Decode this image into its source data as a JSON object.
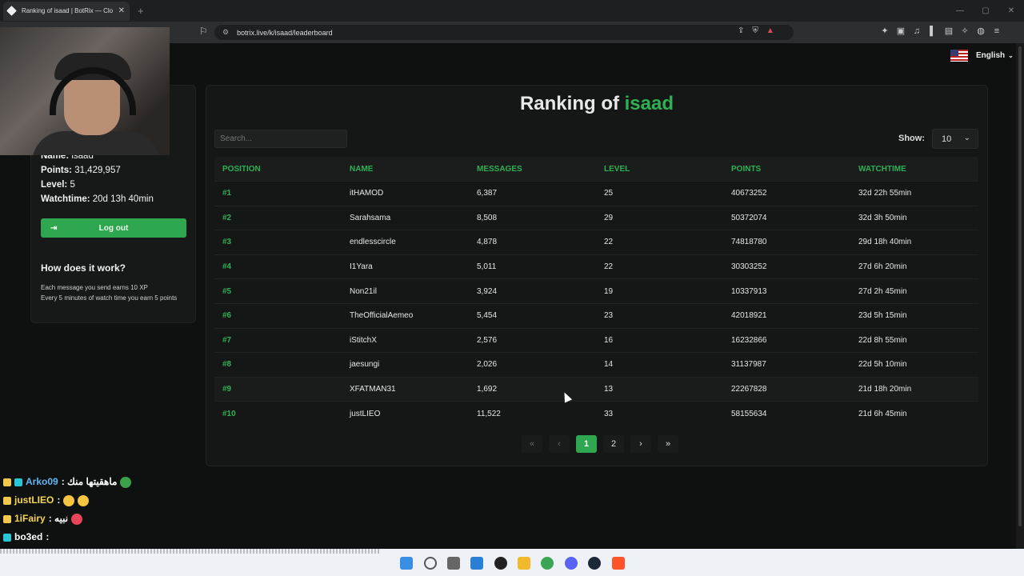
{
  "browser": {
    "tab_title": "Ranking of isaad | BotRix — Clo",
    "url": "botrix.live/k/isaad/leaderboard"
  },
  "language": {
    "label": "English"
  },
  "sidebar": {
    "name_label": "Name:",
    "name_value": "isaad",
    "points_label": "Points:",
    "points_value": "31,429,957",
    "level_label": "Level:",
    "level_value": "5",
    "watchtime_label": "Watchtime:",
    "watchtime_value": "20d 13h 40min",
    "logout_label": "Log out",
    "how_title": "How does it work?",
    "how_line1": "Each message you send earns 10 XP",
    "how_line2": "Every 5 minutes of watch time you earn 5 points"
  },
  "ranking": {
    "title_prefix": "Ranking of",
    "title_name": "isaad",
    "search_placeholder": "Search...",
    "show_label": "Show:",
    "show_value": "10",
    "columns": [
      "POSITION",
      "NAME",
      "MESSAGES",
      "LEVEL",
      "POINTS",
      "WATCHTIME"
    ],
    "rows": [
      {
        "pos": "#1",
        "name": "itHAMOD",
        "messages": "6,387",
        "level": "25",
        "points": "40673252",
        "watchtime": "32d 22h 55min"
      },
      {
        "pos": "#2",
        "name": "Sarahsama",
        "messages": "8,508",
        "level": "29",
        "points": "50372074",
        "watchtime": "32d 3h 50min"
      },
      {
        "pos": "#3",
        "name": "endlesscircle",
        "messages": "4,878",
        "level": "22",
        "points": "74818780",
        "watchtime": "29d 18h 40min"
      },
      {
        "pos": "#4",
        "name": "I1Yara",
        "messages": "5,011",
        "level": "22",
        "points": "30303252",
        "watchtime": "27d 6h 20min"
      },
      {
        "pos": "#5",
        "name": "Non21il",
        "messages": "3,924",
        "level": "19",
        "points": "10337913",
        "watchtime": "27d 2h 45min"
      },
      {
        "pos": "#6",
        "name": "TheOfficialAemeo",
        "messages": "5,454",
        "level": "23",
        "points": "42018921",
        "watchtime": "23d 5h 15min"
      },
      {
        "pos": "#7",
        "name": "iStitchX",
        "messages": "2,576",
        "level": "16",
        "points": "16232866",
        "watchtime": "22d 8h 55min"
      },
      {
        "pos": "#8",
        "name": "jaesungi",
        "messages": "2,026",
        "level": "14",
        "points": "31137987",
        "watchtime": "22d 5h 10min"
      },
      {
        "pos": "#9",
        "name": "XFATMAN31",
        "messages": "1,692",
        "level": "13",
        "points": "22267828",
        "watchtime": "21d 18h 20min"
      },
      {
        "pos": "#10",
        "name": "justLIEO",
        "messages": "11,522",
        "level": "33",
        "points": "58155634",
        "watchtime": "21d 6h 45min"
      }
    ],
    "pages": [
      "1",
      "2"
    ],
    "current_page": "1"
  },
  "chat": [
    {
      "user": "Arko09",
      "msg": ": ماهقيتها منك"
    },
    {
      "user": "justLIEO",
      "msg": ":"
    },
    {
      "user": "1iFairy",
      "msg": ": نبيه"
    },
    {
      "user": "bo3ed",
      "msg": ":"
    }
  ],
  "colors": {
    "accent": "#2fb054",
    "button": "#2fa750",
    "background": "#0f1110"
  }
}
